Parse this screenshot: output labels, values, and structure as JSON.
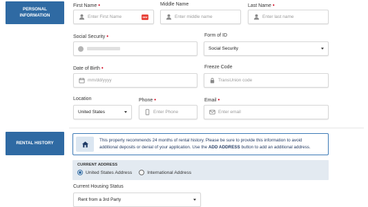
{
  "sections": {
    "personal_title": "PERSONAL INFORMATION",
    "rental_title": "RENTAL HISTORY"
  },
  "fields": {
    "first_name": {
      "label": "First Name",
      "placeholder": "Enter First Name",
      "icon": "person-icon",
      "badge": "NEW"
    },
    "middle_name": {
      "label": "Middle Name",
      "placeholder": "Enter middle name",
      "icon": "person-icon"
    },
    "last_name": {
      "label": "Last Name",
      "placeholder": "Enter last name",
      "icon": "person-icon"
    },
    "ssn": {
      "label": "Social Security",
      "icon": "info-icon"
    },
    "form_of_id": {
      "label": "Form of ID",
      "value": "Social Security"
    },
    "dob": {
      "label": "Date of Birth",
      "placeholder": "mm/dd/yyyy",
      "icon": "calendar-icon"
    },
    "freeze_code": {
      "label": "Freeze Code",
      "placeholder": "TransUnion code",
      "icon": "lock-icon"
    },
    "location": {
      "label": "Location",
      "value": "United States"
    },
    "phone": {
      "label": "Phone",
      "placeholder": "Enter Phone",
      "icon": "phone-icon"
    },
    "email": {
      "label": "Email",
      "placeholder": "Enter email",
      "icon": "mail-icon"
    }
  },
  "rental": {
    "info_line1": "This property recommends 24 months of rental history. Please be sure to provide this information to avoid",
    "info_line2_pre": "additional deposits or denial of your application. Use the ",
    "info_line2_bold": "ADD ADDRESS",
    "info_line2_post": " button to add an additional address.",
    "current_address_title": "CURRENT ADDRESS",
    "radio_us": "United States Address",
    "radio_intl": "International Address",
    "selected_radio": "United States Address",
    "housing_label": "Current Housing Status",
    "housing_value": "Rent from a 3rd Party"
  },
  "colors": {
    "accent": "#2f6aa3",
    "required": "#d0021b",
    "info_border": "#3a78b5",
    "address_bg": "#e3eaf1"
  }
}
